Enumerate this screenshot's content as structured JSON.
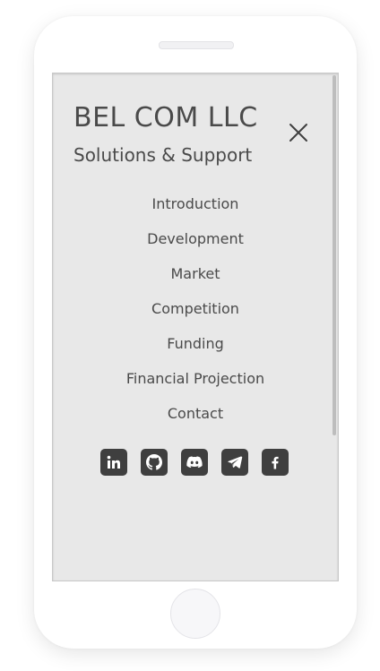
{
  "header": {
    "brand": "BEL COM LLC",
    "tagline": "Solutions & Support"
  },
  "menu": {
    "close_icon": "close-icon",
    "items": [
      {
        "label": "Introduction"
      },
      {
        "label": "Development"
      },
      {
        "label": "Market"
      },
      {
        "label": "Competition"
      },
      {
        "label": "Funding"
      },
      {
        "label": "Financial Projection"
      },
      {
        "label": "Contact"
      }
    ]
  },
  "social": [
    {
      "icon": "linkedin-icon"
    },
    {
      "icon": "github-icon"
    },
    {
      "icon": "discord-icon"
    },
    {
      "icon": "telegram-icon"
    },
    {
      "icon": "facebook-icon"
    }
  ],
  "colors": {
    "screen_background": "#e8e8e8",
    "text": "#4a4a4a",
    "social_button": "#3f3f3f"
  }
}
